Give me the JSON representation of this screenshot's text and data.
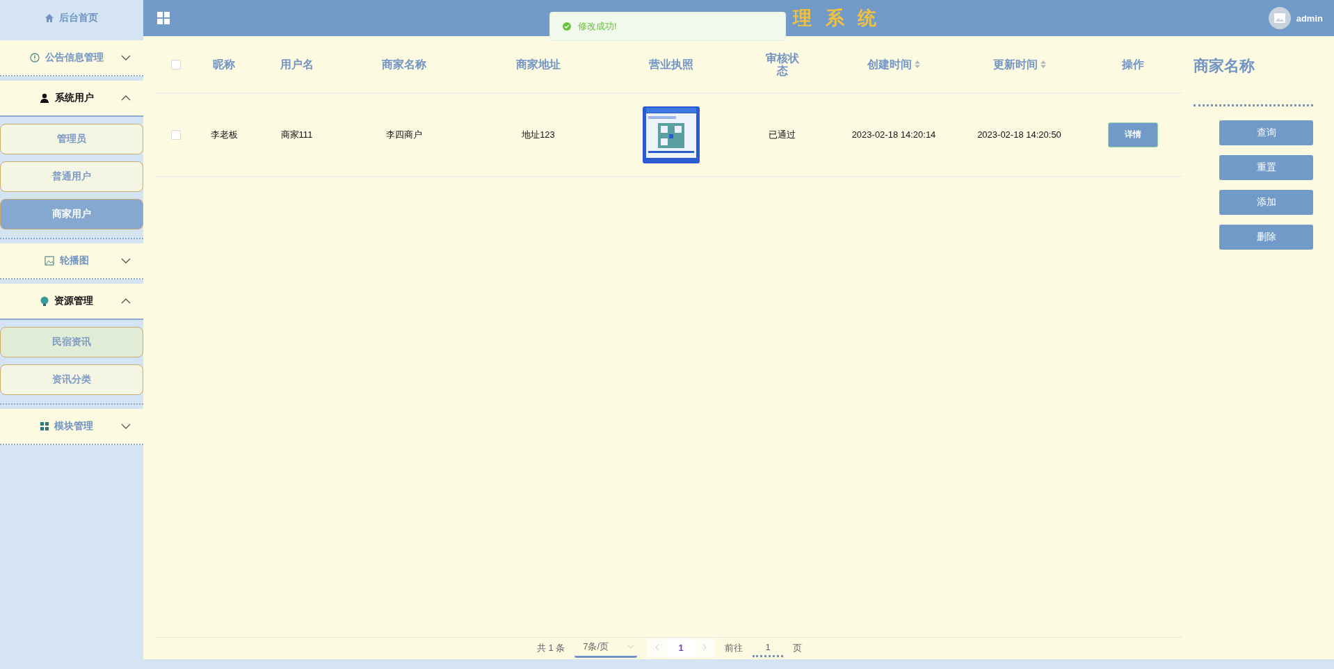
{
  "sidebar": {
    "home": {
      "label": "后台首页",
      "selected": false
    },
    "groups": [
      {
        "label": "公告信息管理",
        "expanded": false
      },
      {
        "label": "系统用户",
        "expanded": true,
        "children": [
          {
            "label": "管理员",
            "selected": false,
            "highlighted": false
          },
          {
            "label": "普通用户",
            "selected": false,
            "highlighted": false
          },
          {
            "label": "商家用户",
            "selected": true,
            "highlighted": false
          }
        ]
      },
      {
        "label": "轮播图",
        "expanded": false
      },
      {
        "label": "资源管理",
        "expanded": true,
        "children": [
          {
            "label": "民宿资讯",
            "selected": false,
            "highlighted": true
          },
          {
            "label": "资讯分类",
            "selected": false,
            "highlighted": false
          }
        ]
      },
      {
        "label": "模块管理",
        "expanded": false
      }
    ]
  },
  "header": {
    "title": "理 系 统",
    "user": "admin"
  },
  "toast": {
    "message": "修改成功!"
  },
  "table": {
    "columns": [
      {
        "label": "昵称",
        "sortable": false
      },
      {
        "label": "用户名",
        "sortable": false
      },
      {
        "label": "商家名称",
        "sortable": false
      },
      {
        "label": "商家地址",
        "sortable": false
      },
      {
        "label": "营业执照",
        "sortable": false
      },
      {
        "label": "审核状态",
        "sortable": false
      },
      {
        "label": "创建时间",
        "sortable": true
      },
      {
        "label": "更新时间",
        "sortable": true
      },
      {
        "label": "操作",
        "sortable": false
      }
    ],
    "header_checked": false,
    "rows": [
      {
        "checked": false,
        "cells": [
          {
            "kind": "text",
            "value": "李老板"
          },
          {
            "kind": "text",
            "value": "商家111"
          },
          {
            "kind": "text",
            "value": "李四商户"
          },
          {
            "kind": "text",
            "value": "地址123"
          },
          {
            "kind": "picture"
          },
          {
            "kind": "text",
            "value": "已通过"
          },
          {
            "kind": "text",
            "value": "2023-02-18 14:20:14"
          },
          {
            "kind": "text",
            "value": "2023-02-18 14:20:50"
          },
          {
            "kind": "button",
            "value": "详情"
          }
        ]
      }
    ]
  },
  "pagination": {
    "total": "共 1 条",
    "page_size": "7条/页",
    "pages": [
      {
        "label": "1",
        "selected": true
      }
    ],
    "goto_label": "前往",
    "goto_value": "1",
    "goto_suffix": "页"
  },
  "search_panel": {
    "title": "商家名称",
    "buttons": [
      "查询",
      "重置",
      "添加",
      "删除"
    ]
  }
}
